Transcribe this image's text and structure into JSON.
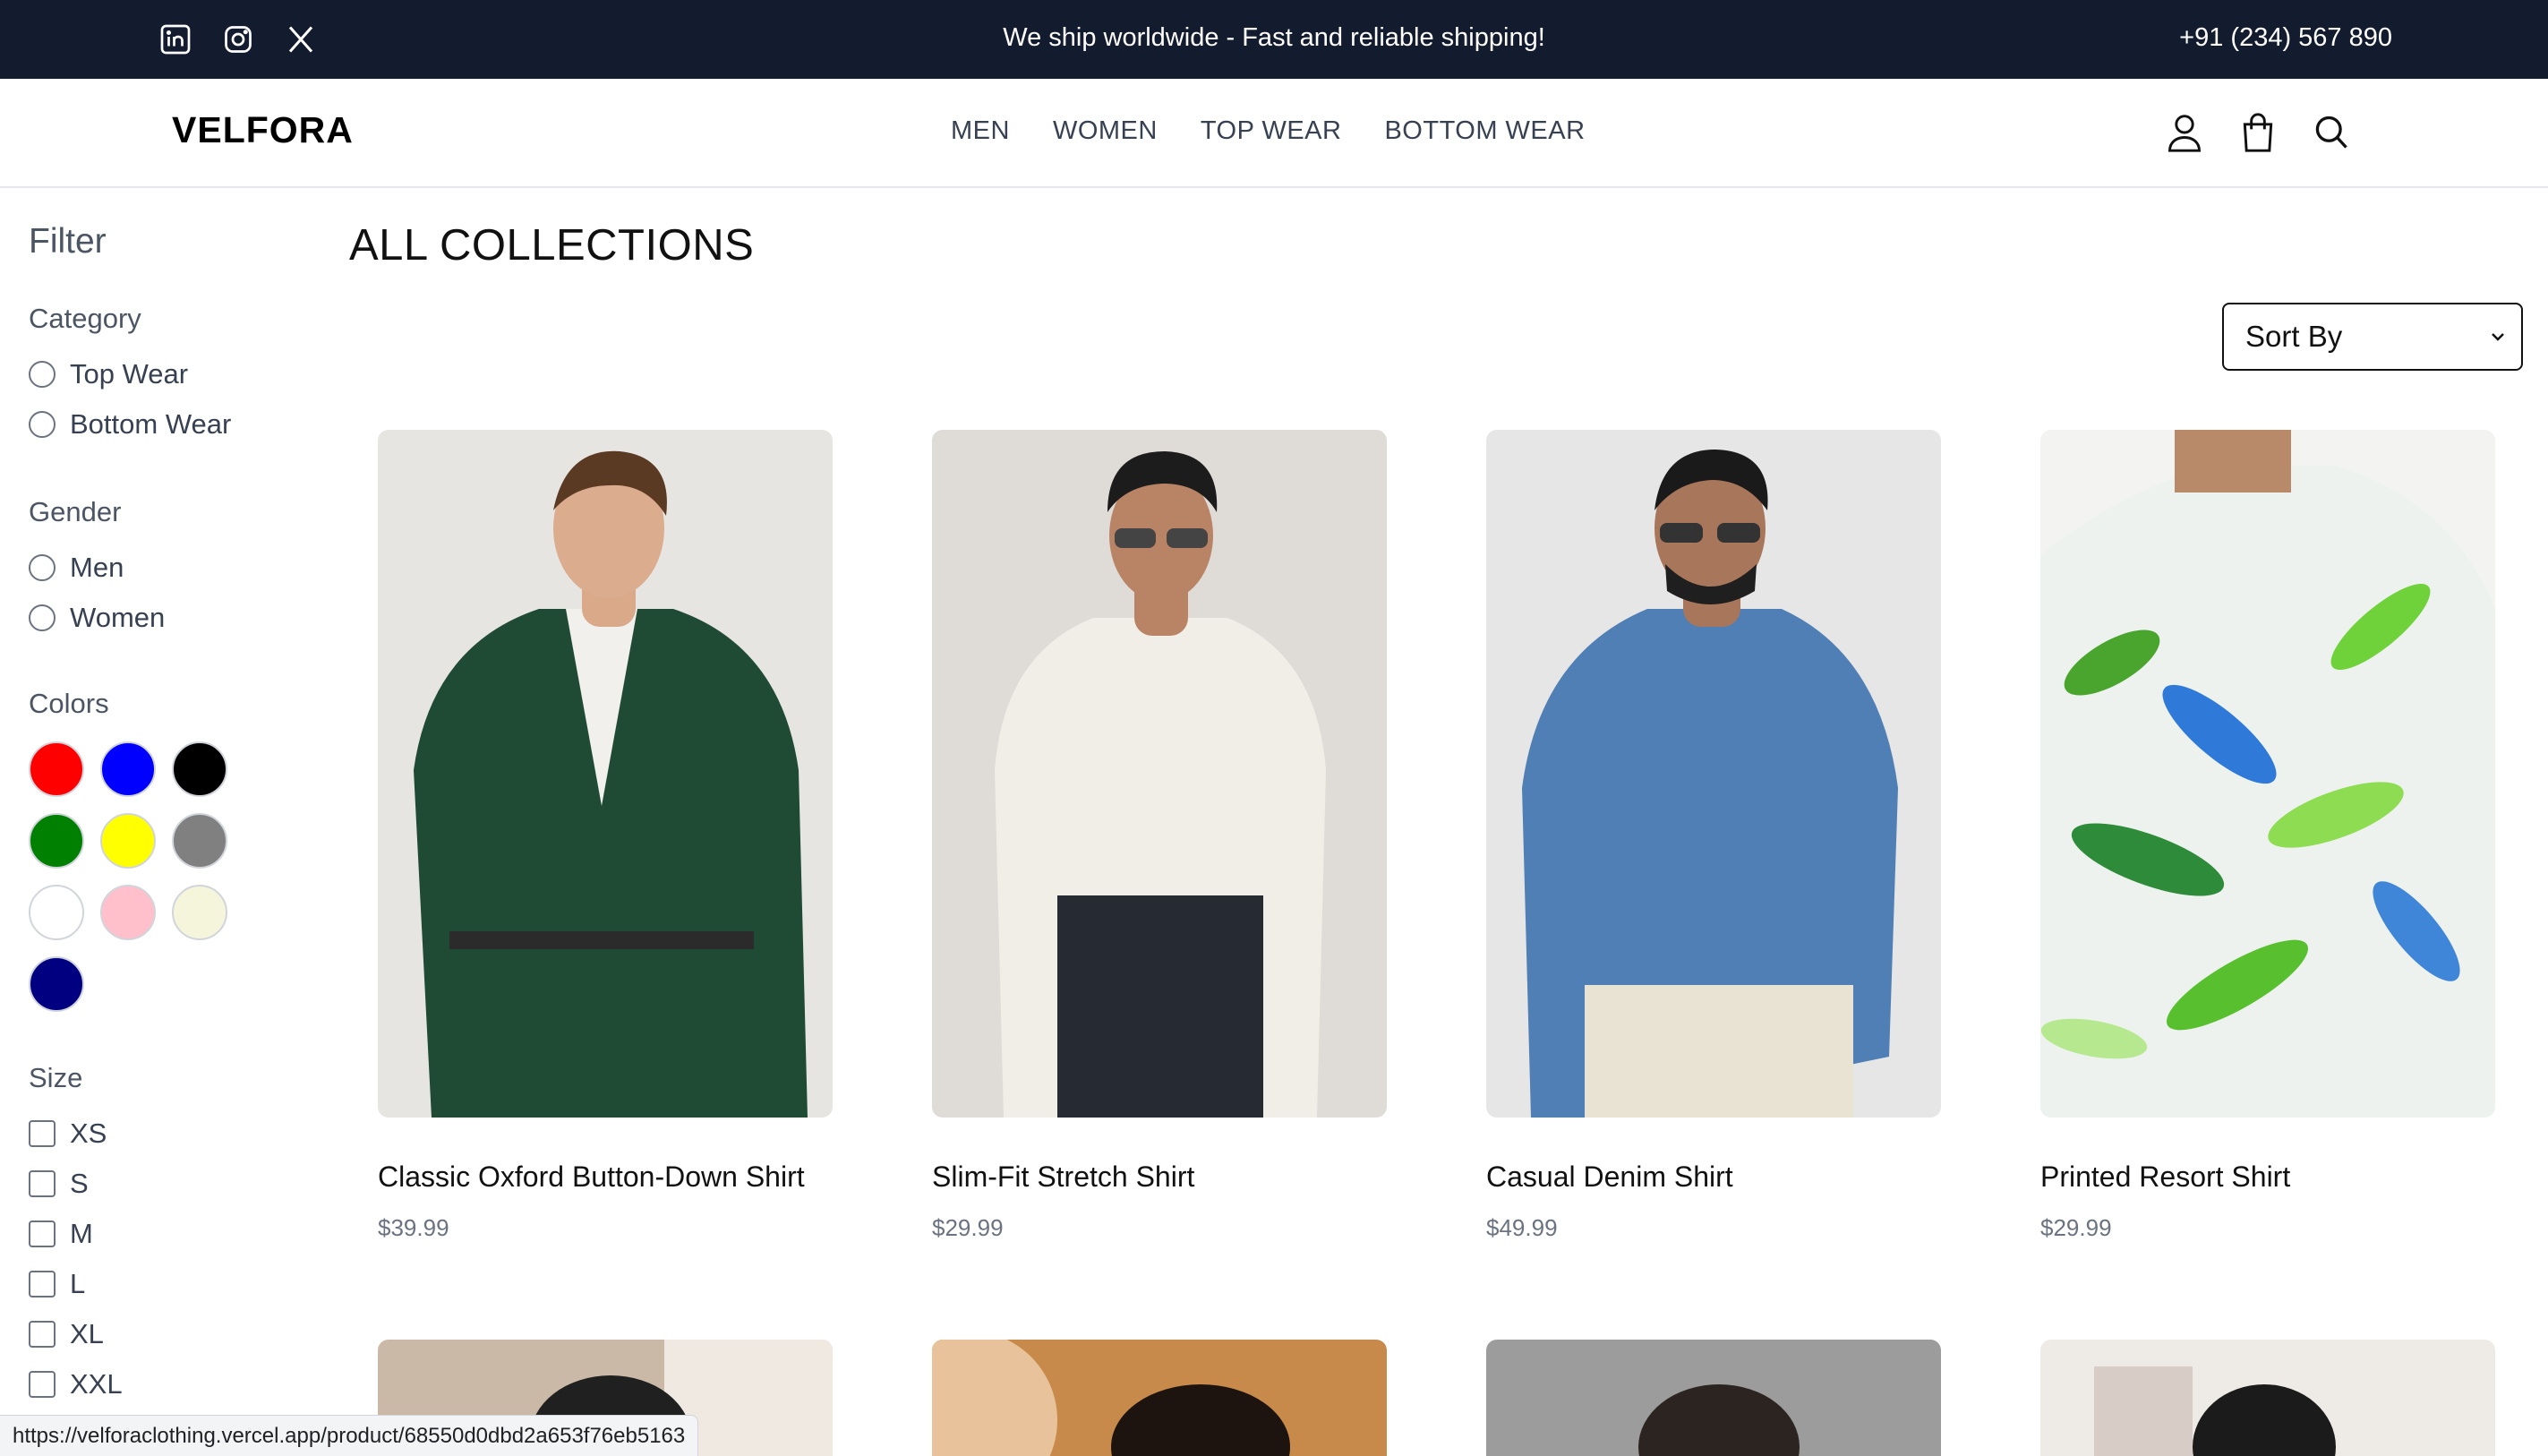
{
  "topbar": {
    "announcement": "We ship worldwide - Fast and reliable shipping!",
    "phone": "+91 (234) 567 890",
    "socials": [
      "linkedin-icon",
      "instagram-icon",
      "x-icon"
    ]
  },
  "nav": {
    "logo": "VELFORA",
    "links": [
      "MEN",
      "WOMEN",
      "TOP WEAR",
      "BOTTOM WEAR"
    ],
    "icons": [
      "user-icon",
      "shopping-bag-icon",
      "search-icon"
    ]
  },
  "filter": {
    "title": "Filter",
    "category": {
      "label": "Category",
      "options": [
        "Top Wear",
        "Bottom Wear"
      ]
    },
    "gender": {
      "label": "Gender",
      "options": [
        "Men",
        "Women"
      ]
    },
    "colors": {
      "label": "Colors",
      "swatches": [
        "#ff0000",
        "#0000ff",
        "#000000",
        "#008000",
        "#ffff00",
        "#808080",
        "#ffffff",
        "#ffc0cb",
        "#f5f5dc",
        "#000080"
      ]
    },
    "size": {
      "label": "Size",
      "options": [
        "XS",
        "S",
        "M",
        "L",
        "XL",
        "XXL"
      ]
    }
  },
  "main": {
    "title": "ALL COLLECTIONS",
    "sort_label": "Sort By",
    "products": [
      {
        "name": "Classic Oxford Button-Down Shirt",
        "price": "$39.99"
      },
      {
        "name": "Slim-Fit Stretch Shirt",
        "price": "$29.99"
      },
      {
        "name": "Casual Denim Shirt",
        "price": "$49.99"
      },
      {
        "name": "Printed Resort Shirt",
        "price": "$29.99"
      }
    ]
  },
  "status_url": "https://velforaclothing.vercel.app/product/68550d0dbd2a653f76eb5163"
}
